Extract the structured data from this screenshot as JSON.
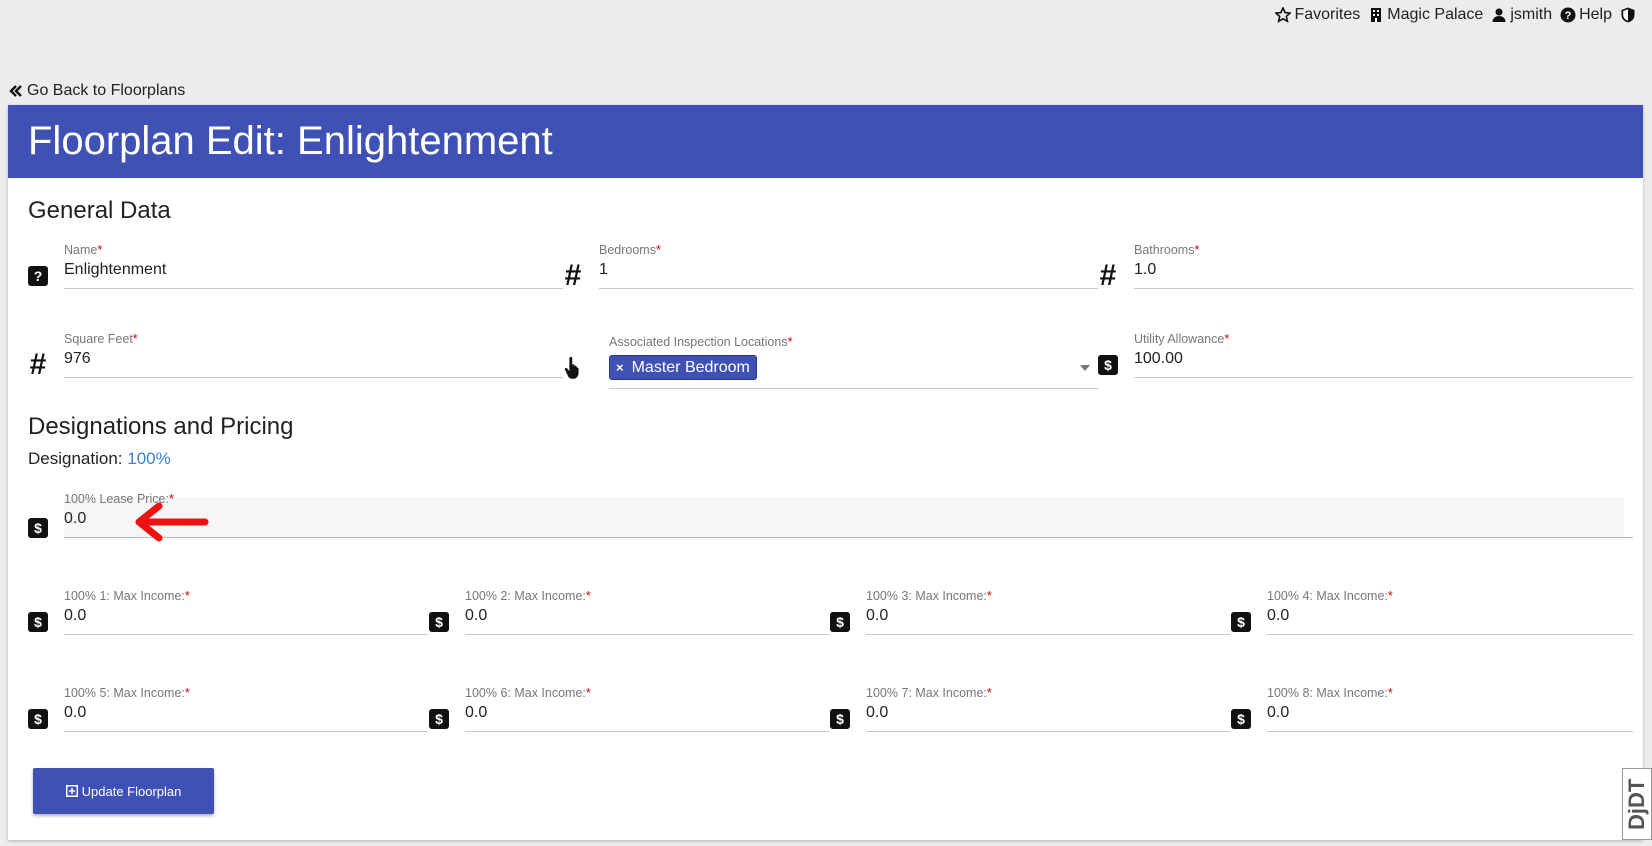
{
  "topnav": {
    "favorites": "Favorites",
    "property": "Magic Palace",
    "user": "jsmith",
    "help": "Help"
  },
  "back_link": "Go Back to Floorplans",
  "header": {
    "title": "Floorplan Edit: Enlightenment"
  },
  "general": {
    "title": "General Data",
    "name": {
      "label": "Name",
      "value": "Enlightenment"
    },
    "bedrooms": {
      "label": "Bedrooms",
      "value": "1"
    },
    "bathrooms": {
      "label": "Bathrooms",
      "value": "1.0"
    },
    "square_feet": {
      "label": "Square Feet",
      "value": "976"
    },
    "inspection_locations": {
      "label": "Associated Inspection Locations",
      "chip": "Master Bedroom"
    },
    "utility_allowance": {
      "label": "Utility Allowance",
      "value": "100.00"
    }
  },
  "designations": {
    "title": "Designations and Pricing",
    "designation_label": "Designation:",
    "designation_value": "100%",
    "lease_price": {
      "label": "100% Lease Price:",
      "value": "0.0"
    },
    "max_incomes": [
      {
        "label": "100% 1: Max Income:",
        "value": "0.0"
      },
      {
        "label": "100% 2: Max Income:",
        "value": "0.0"
      },
      {
        "label": "100% 3: Max Income:",
        "value": "0.0"
      },
      {
        "label": "100% 4: Max Income:",
        "value": "0.0"
      },
      {
        "label": "100% 5: Max Income:",
        "value": "0.0"
      },
      {
        "label": "100% 6: Max Income:",
        "value": "0.0"
      },
      {
        "label": "100% 7: Max Income:",
        "value": "0.0"
      },
      {
        "label": "100% 8: Max Income:",
        "value": "0.0"
      }
    ]
  },
  "required_mark": "*",
  "currency_glyph": "$",
  "hash_glyph": "#",
  "question_glyph": "?",
  "chip_remove": "×",
  "update_button": "Update Floorplan",
  "debug_toolbar": "DjDT",
  "colors": {
    "primary": "#3f51b5",
    "required": "#dd0000",
    "link": "#3f7fd0",
    "annotation_arrow": "#ee1111"
  }
}
